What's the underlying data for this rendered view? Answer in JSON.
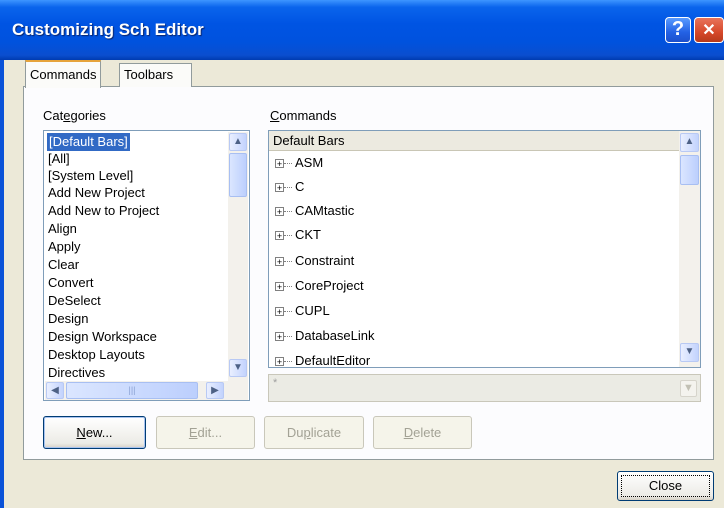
{
  "window": {
    "title": "Customizing Sch Editor",
    "help_glyph": "?",
    "close_glyph": "✕"
  },
  "tabs": [
    {
      "label": "Commands",
      "active": true
    },
    {
      "label": "Toolbars",
      "active": false
    }
  ],
  "categories": {
    "label_prefix": "Cat",
    "label_mnemonic": "e",
    "label_suffix": "gories",
    "items": [
      "[Default Bars]",
      "[All]",
      "[System Level]",
      "Add New Project",
      "Add New to Project",
      "Align",
      "Apply",
      "Clear",
      "Convert",
      "DeSelect",
      "Design",
      "Design Workspace",
      "Desktop Layouts",
      "Directives"
    ],
    "selected": "[Default Bars]"
  },
  "commands": {
    "label_mnemonic": "C",
    "label_suffix": "ommands",
    "header": "Default Bars",
    "items": [
      "ASM",
      "C",
      "CAMtastic",
      "CKT",
      "Constraint",
      "CoreProject",
      "CUPL",
      "DatabaseLink",
      "DefaultEditor"
    ],
    "combo_value": "*"
  },
  "buttons": {
    "new": {
      "mnemonic": "N",
      "suffix": "ew..."
    },
    "edit": {
      "mnemonic": "E",
      "suffix": "dit..."
    },
    "duplicate": {
      "prefix": "Du",
      "mnemonic": "p",
      "suffix": "licate"
    },
    "delete": {
      "mnemonic": "D",
      "suffix": "elete"
    },
    "close": "Close"
  },
  "icons": {
    "expand": "+",
    "scroll_up": "▲",
    "scroll_down": "▼",
    "scroll_left": "◀",
    "scroll_right": "▶",
    "combo_down": "▼",
    "grip": "|||"
  }
}
